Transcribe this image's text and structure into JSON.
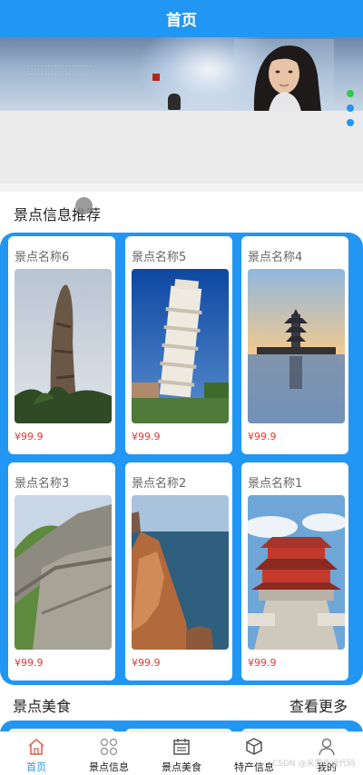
{
  "header": {
    "title": "首页"
  },
  "carousel": {
    "dots": 3,
    "active_index": 0
  },
  "attractions_section": {
    "title": "景点信息推荐"
  },
  "attractions": [
    {
      "name": "景点名称6",
      "price": "¥99.9",
      "photo": "rock-pillar"
    },
    {
      "name": "景点名称5",
      "price": "¥99.9",
      "photo": "leaning-tower"
    },
    {
      "name": "景点名称4",
      "price": "¥99.9",
      "photo": "pagoda-lake"
    },
    {
      "name": "景点名称3",
      "price": "¥99.9",
      "photo": "great-wall"
    },
    {
      "name": "景点名称2",
      "price": "¥99.9",
      "photo": "sea-cliff"
    },
    {
      "name": "景点名称1",
      "price": "¥99.9",
      "photo": "chinese-pavilion"
    }
  ],
  "food_section": {
    "title": "景点美食",
    "more_label": "查看更多"
  },
  "tabbar": {
    "items": [
      {
        "label": "首页",
        "icon": "home-icon",
        "active": true
      },
      {
        "label": "景点信息",
        "icon": "grid-icon",
        "active": false
      },
      {
        "label": "景点美食",
        "icon": "calendar-icon",
        "active": false
      },
      {
        "label": "特产信息",
        "icon": "box-icon",
        "active": false
      },
      {
        "label": "我的",
        "icon": "user-icon",
        "active": false
      }
    ]
  },
  "watermark": "CSDN @米罗毕设代码",
  "colors": {
    "primary": "#2196f3",
    "price": "#e53935",
    "carousel_active_dot": "#2ecc40"
  }
}
